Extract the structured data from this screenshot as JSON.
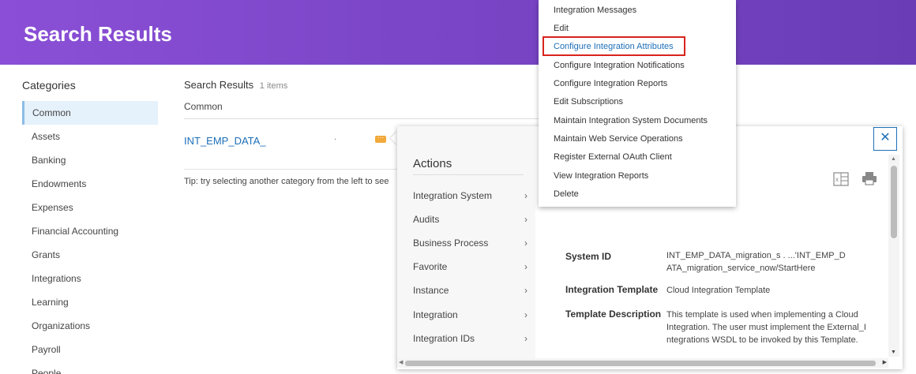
{
  "header": {
    "title": "Search Results"
  },
  "categories": {
    "heading": "Categories",
    "items": [
      "Common",
      "Assets",
      "Banking",
      "Endowments",
      "Expenses",
      "Financial Accounting",
      "Grants",
      "Integrations",
      "Learning",
      "Organizations",
      "Payroll",
      "People"
    ]
  },
  "results": {
    "heading": "Search Results",
    "count": "1 items",
    "category": "Common",
    "link": "INT_EMP_DATA_",
    "dot": ".",
    "related_icon": "related-actions-icon",
    "tip": "Tip: try selecting another category from the left to see"
  },
  "actions": {
    "title": "Actions",
    "items": [
      "Integration System",
      "Audits",
      "Business Process",
      "Favorite",
      "Instance",
      "Integration",
      "Integration IDs"
    ]
  },
  "submenu": {
    "items": [
      "Integration Messages",
      "Edit",
      "Configure Integration Attributes",
      "Configure Integration Notifications",
      "Configure Integration Reports",
      "Edit Subscriptions",
      "Maintain Integration System Documents",
      "Maintain Web Service Operations",
      "Register External OAuth Client",
      "View Integration Reports",
      "Delete"
    ],
    "highlighted_index": 2
  },
  "detail": {
    "link_fragment": "r",
    "rows": [
      {
        "label": "System ID",
        "value_lines": [
          "INT_EMP_DATA_migration_s        .     ...'INT_EMP_D",
          "ATA_migration_service_now/StartHere"
        ]
      },
      {
        "label": "Integration Template",
        "value_lines": [
          "Cloud Integration Template"
        ]
      },
      {
        "label": "Template Description",
        "value_lines": [
          "This template is used when implementing a Cloud",
          "Integration.  The user must implement the External_I",
          "ntegrations WSDL to be invoked by this Template."
        ]
      }
    ]
  },
  "colors": {
    "header": "#7a45c6",
    "link": "#1d6fb8",
    "highlight_box": "#d9231d",
    "active_category": "#e5f1fb"
  }
}
